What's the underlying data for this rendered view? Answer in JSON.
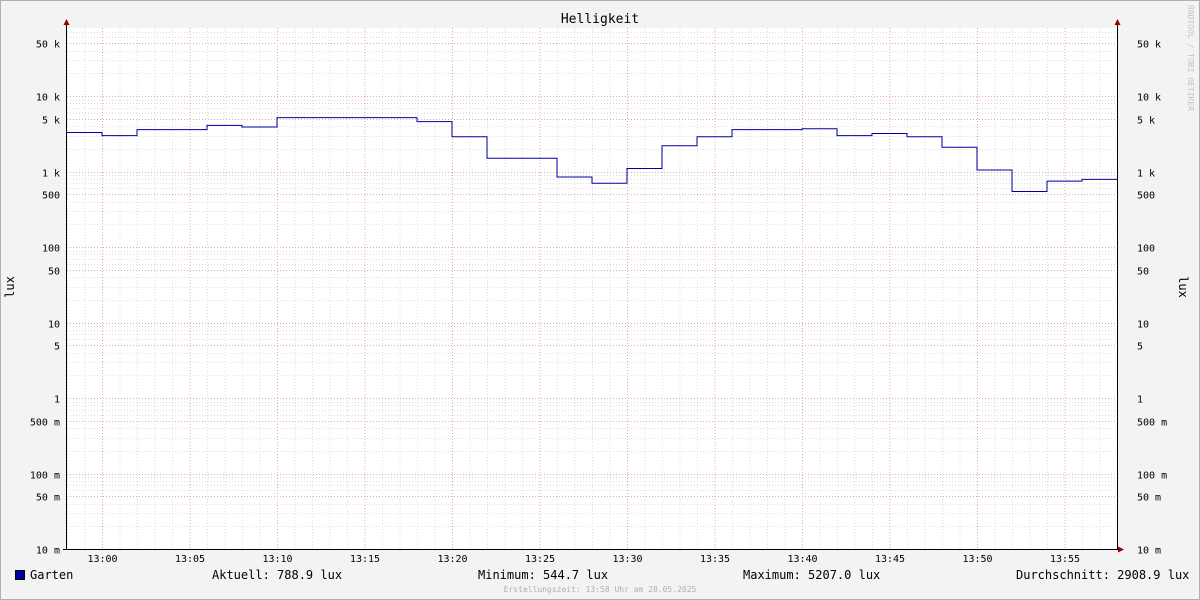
{
  "chart_data": {
    "type": "line",
    "title": "Helligkeit",
    "ylabel": "lux",
    "yscale": "log",
    "ylim": [
      0.01,
      80000
    ],
    "xlim": [
      "12:58",
      "13:58"
    ],
    "x_ticks": [
      "13:00",
      "13:05",
      "13:10",
      "13:15",
      "13:20",
      "13:25",
      "13:30",
      "13:35",
      "13:40",
      "13:45",
      "13:50",
      "13:55"
    ],
    "y_ticks": [
      {
        "value": 50000,
        "label": "50 k"
      },
      {
        "value": 10000,
        "label": "10 k"
      },
      {
        "value": 5000,
        "label": "5 k"
      },
      {
        "value": 1000,
        "label": "1 k"
      },
      {
        "value": 500,
        "label": "500"
      },
      {
        "value": 100,
        "label": "100"
      },
      {
        "value": 50,
        "label": "50"
      },
      {
        "value": 10,
        "label": "10"
      },
      {
        "value": 5,
        "label": "5"
      },
      {
        "value": 1,
        "label": "1"
      },
      {
        "value": 0.5,
        "label": "500 m"
      },
      {
        "value": 0.1,
        "label": "100 m"
      },
      {
        "value": 0.05,
        "label": "50 m"
      },
      {
        "value": 0.01,
        "label": "10 m"
      }
    ],
    "grid": true,
    "series": [
      {
        "name": "Garten",
        "color": "#0000a0",
        "step": true,
        "x": [
          "12:58",
          "13:00",
          "13:02",
          "13:04",
          "13:06",
          "13:08",
          "13:10",
          "13:12",
          "13:14",
          "13:16",
          "13:18",
          "13:20",
          "13:22",
          "13:24",
          "13:26",
          "13:28",
          "13:30",
          "13:32",
          "13:34",
          "13:36",
          "13:38",
          "13:40",
          "13:42",
          "13:44",
          "13:46",
          "13:48",
          "13:50",
          "13:52",
          "13:54",
          "13:56",
          "13:58"
        ],
        "values": [
          3300,
          3000,
          3600,
          3600,
          4100,
          3900,
          5200,
          5200,
          5200,
          5200,
          4600,
          2900,
          1500,
          1500,
          850,
          700,
          1100,
          2200,
          2900,
          3600,
          3600,
          3700,
          3000,
          3200,
          2900,
          2100,
          1050,
          545,
          750,
          790,
          790
        ]
      }
    ]
  },
  "legend": {
    "series_name": "Garten",
    "current": "Aktuell: 788.9 lux",
    "minimum": "Minimum: 544.7 lux",
    "maximum": "Maximum: 5207.0 lux",
    "average": "Durchschnitt: 2908.9 lux"
  },
  "footer": "Erstellungszeit: 13:58 Uhr am 28.05.2025",
  "watermark": "RRDTOOL / TOBI OETIKER"
}
